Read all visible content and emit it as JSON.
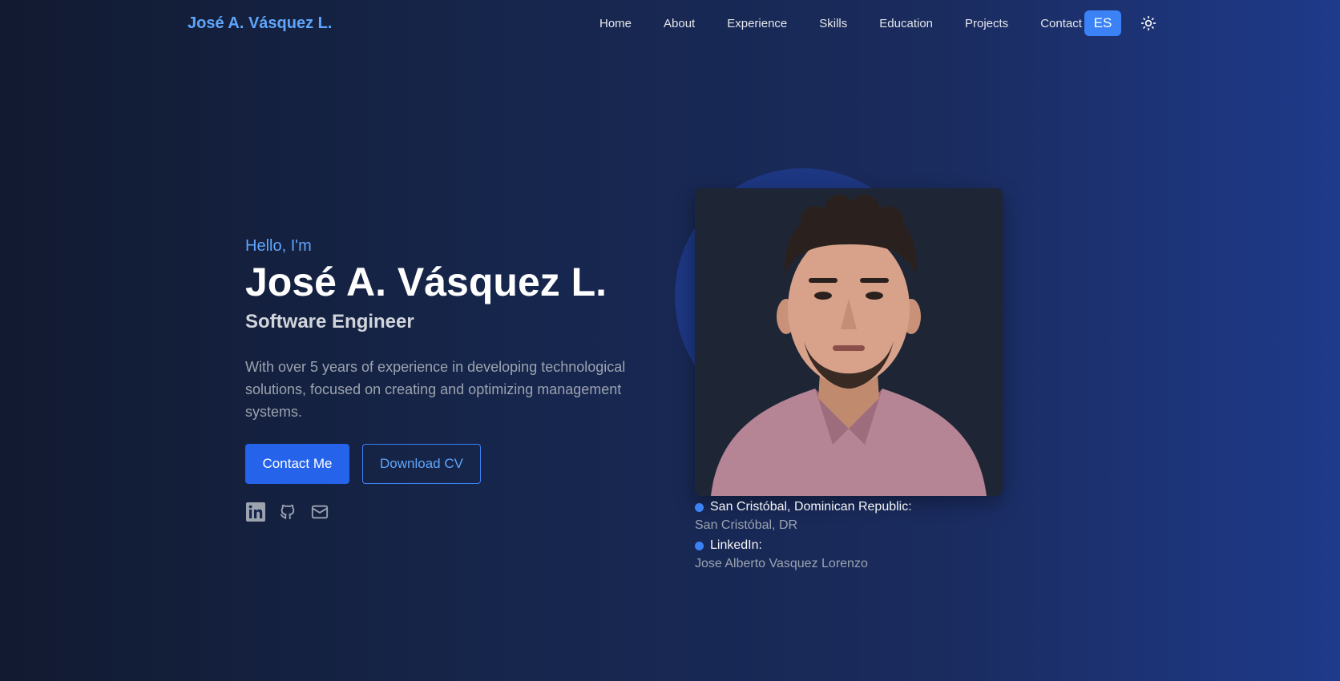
{
  "header": {
    "brand": "José A. Vásquez L.",
    "nav": [
      "Home",
      "About",
      "Experience",
      "Skills",
      "Education",
      "Projects",
      "Contact"
    ],
    "lang_button": "ES",
    "theme_icon": "sun-icon"
  },
  "hero": {
    "greeting": "Hello, I'm",
    "name": "José A. Vásquez L.",
    "role": "Software Engineer",
    "bio": "With over 5 years of experience in developing technological solutions, focused on creating and optimizing management systems.",
    "contact_button": "Contact Me",
    "cv_button": "Download CV",
    "socials": [
      "linkedin-icon",
      "github-icon",
      "mail-icon"
    ]
  },
  "profile": {
    "location_label": "San Cristóbal, Dominican Republic:",
    "location_value": "San Cristóbal, DR",
    "linkedin_label": "LinkedIn:",
    "linkedin_value": "Jose Alberto Vasquez Lorenzo"
  },
  "colors": {
    "accent": "#3b82f6",
    "accent_light": "#60a5fa",
    "primary_button": "#2563eb",
    "background_start": "#111a30",
    "background_end": "#1e3a8a"
  }
}
